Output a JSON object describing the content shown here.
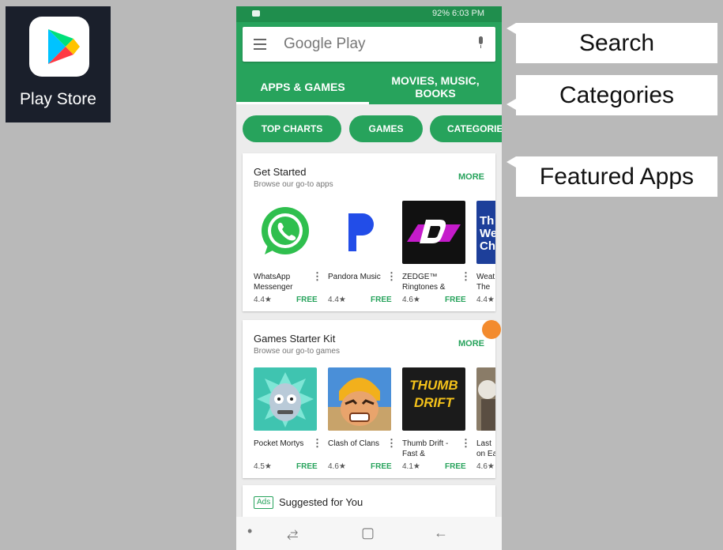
{
  "play_store_tile": {
    "label": "Play Store",
    "icon": "play-triangle-icon"
  },
  "status_bar": {
    "text": "92% 6:03 PM"
  },
  "search": {
    "placeholder": "Google Play",
    "menu_icon": "hamburger-icon",
    "mic_icon": "microphone-icon"
  },
  "tabs": [
    {
      "label": "APPS & GAMES",
      "selected": true
    },
    {
      "label": "MOVIES, MUSIC, BOOKS",
      "selected": false
    }
  ],
  "chips": [
    "TOP CHARTS",
    "GAMES",
    "CATEGORIE"
  ],
  "sections": [
    {
      "title": "Get Started",
      "subtitle": "Browse our go-to apps",
      "more": "MORE",
      "apps": [
        {
          "name": "WhatsApp Messenger",
          "rating": "4.4★",
          "price": "FREE"
        },
        {
          "name": "Pandora Music",
          "rating": "4.4★",
          "price": "FREE"
        },
        {
          "name": "ZEDGE™ Ringtones &",
          "rating": "4.6★",
          "price": "FREE"
        },
        {
          "name": "Weat - The",
          "rating": "4.4★",
          "price": "",
          "icon_text": "Th We Ch"
        }
      ]
    },
    {
      "title": "Games Starter Kit",
      "subtitle": "Browse our go-to games",
      "more": "MORE",
      "apps": [
        {
          "name": "Pocket Mortys",
          "rating": "4.5★",
          "price": "FREE"
        },
        {
          "name": "Clash of Clans",
          "rating": "4.6★",
          "price": "FREE"
        },
        {
          "name": "Thumb Drift - Fast &",
          "rating": "4.1★",
          "price": "FREE",
          "icon_text": "THUMB DRIFT"
        },
        {
          "name": "Last on Ea",
          "rating": "4.6★",
          "price": ""
        }
      ]
    }
  ],
  "suggested": {
    "badge": "Ads",
    "title": "Suggested for You"
  },
  "callouts": [
    "Search",
    "Categories",
    "Featured Apps"
  ],
  "colors": {
    "header_green": "#27a35c",
    "status_green": "#1f8e4d",
    "record_orange": "#f38b2e"
  }
}
